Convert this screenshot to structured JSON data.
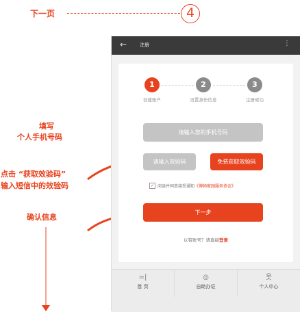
{
  "annotation": {
    "next_page": "下一页",
    "step_number": "4",
    "fill_line1": "填写",
    "fill_line2": "个人手机号码",
    "code_line1": "点击 “获取效验码”",
    "code_line2": "输入短信中的效验码",
    "confirm": "确认信息"
  },
  "appbar": {
    "back_icon": "←",
    "title": "注册",
    "menu_icon": "⋮"
  },
  "steps": [
    {
      "number": "1",
      "label": "创建账户",
      "state": "active"
    },
    {
      "number": "2",
      "label": "设置身份信息",
      "state": "inactive"
    },
    {
      "number": "3",
      "label": "注册成功",
      "state": "inactive"
    }
  ],
  "form": {
    "phone_placeholder": "请输入您的手机号码",
    "code_placeholder": "请输入效验码",
    "get_code_label": "免费获取效验码",
    "agree_prefix": "阅读并同意接受通知",
    "agree_link": "《博物家园服务协议》",
    "next_label": "下一步",
    "login_prefix": "以有账号？请直接",
    "login_link": "登录"
  },
  "bottom_nav": [
    {
      "icon": "home-icon",
      "icon_glyph": "=|",
      "label": "首 页"
    },
    {
      "icon": "location-icon",
      "icon_glyph": "◎",
      "label": "自助办证"
    },
    {
      "icon": "user-icon",
      "icon_glyph": "웃",
      "label": "个人中心"
    }
  ],
  "colors": {
    "accent": "#e8431f",
    "appbar": "#3a3a3a",
    "disabled": "#c4c4c4"
  }
}
